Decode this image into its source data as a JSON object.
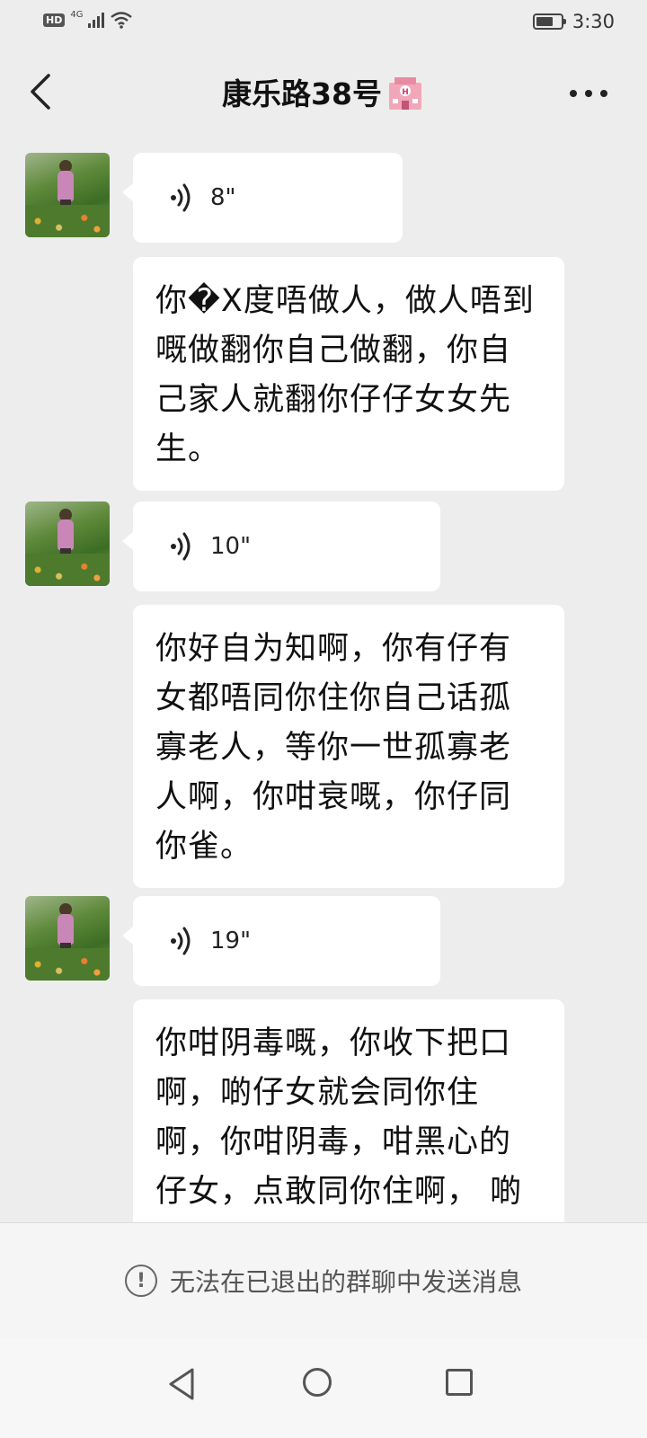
{
  "status_bar": {
    "hd": "HD",
    "network": "4G",
    "time": "3:30",
    "icons": [
      "hd-badge",
      "signal-icon",
      "wifi-icon",
      "battery-icon"
    ]
  },
  "header": {
    "title": "康乐路38号",
    "title_emoji_icon": "hotel-icon",
    "back_icon": "back-icon",
    "more_icon": "more-icon"
  },
  "messages": [
    {
      "type": "voice",
      "duration": "8\""
    },
    {
      "type": "text",
      "text": "你�X度唔做人，做人唔到嘅做翻你自己做翻，你自己家人就翻你仔仔女女先生。"
    },
    {
      "type": "voice",
      "duration": "10\""
    },
    {
      "type": "text",
      "text": "你好自为知啊，你有仔有女都唔同你住你自己话孤寡老人，等你一世孤寡老人啊，你咁衰嘅，你仔同你雀。"
    },
    {
      "type": "voice",
      "duration": "19\""
    },
    {
      "type": "text",
      "text": "你咁阴毒嘅，你收下把口啊，啲仔女就会同你住啊，你咁阴毒，咁黑心的仔女，点敢同你住啊， 啲仔女，费事嘢会嘢咀野野生病毒"
    }
  ],
  "notice": {
    "text": "无法在已退出的群聊中发送消息",
    "icon": "warning-icon"
  },
  "nav": {
    "icons": [
      "nav-back-icon",
      "nav-home-icon",
      "nav-recent-icon"
    ]
  }
}
